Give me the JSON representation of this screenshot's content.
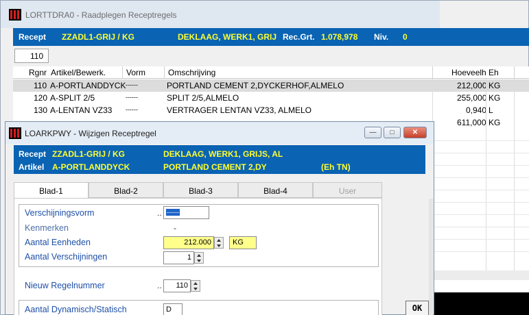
{
  "bg": {
    "title": "LORTTDRA0 - Raadplegen Receptregels",
    "hdr": {
      "recept_label": "Recept",
      "recept_code": "ZZADL1-GRIJ / KG",
      "desc": "DEKLAAG, WERK1, GRIJ",
      "recgrt_label": "Rec.Grt.",
      "recgrt": "1.078,978",
      "niv_label": "Niv.",
      "niv": "0"
    },
    "filter": "110",
    "cols": [
      "Rgnr",
      "Artikel/Bewerk.",
      "Vorm",
      "Omschrijving",
      "Hoeveelh",
      "Eh"
    ],
    "rows": [
      {
        "rgnr": "110",
        "art": "A-PORTLANDDYCK",
        "vorm": "------",
        "oms": "PORTLAND CEMENT 2,DYCKERHOF,ALMELO",
        "hv": "212,000",
        "eh": "KG"
      },
      {
        "rgnr": "120",
        "art": "A-SPLIT 2/5",
        "vorm": "------",
        "oms": "SPLIT 2/5,ALMELO",
        "hv": "255,000",
        "eh": "KG"
      },
      {
        "rgnr": "130",
        "art": "A-LENTAN VZ33",
        "vorm": "------",
        "oms": "VERTRAGER LENTAN VZ33, ALMELO",
        "hv": "0,940",
        "eh": "L"
      },
      {
        "rgnr": "",
        "art": "",
        "vorm": "",
        "oms": "",
        "hv": "611,000",
        "eh": "KG"
      }
    ]
  },
  "dlg": {
    "title": "LOARKPWY - Wijzigen Receptregel",
    "hdr": {
      "recept_label": "Recept",
      "recept_code": "ZZADL1-GRIJ / KG",
      "recept_desc": "DEKLAAG, WERK1, GRIJS, AL",
      "art_label": "Artikel",
      "art_code": "A-PORTLANDDYCK",
      "art_desc": "PORTLAND CEMENT 2,DY",
      "eh": "(Eh TN)"
    },
    "tabs": [
      "Blad-1",
      "Blad-2",
      "Blad-3",
      "Blad-4",
      "User"
    ],
    "ok": "OK",
    "fields": {
      "verschijningsvorm": "Verschijningsvorm",
      "vorm_val": "------",
      "kenmerken": "Kenmerken",
      "kenm_val": "-",
      "aantal_eenheden": "Aantal Eenheden",
      "eenheden_val": "212.000",
      "eenheid": "KG",
      "aantal_verschijningen": "Aantal Verschijningen",
      "versch_val": "1",
      "nieuw_regelnummer": "Nieuw Regelnummer",
      "regel_val": "110",
      "aantal_dyn": "Aantal Dynamisch/Statisch",
      "dyn_val": "D",
      "dots": ".."
    }
  }
}
